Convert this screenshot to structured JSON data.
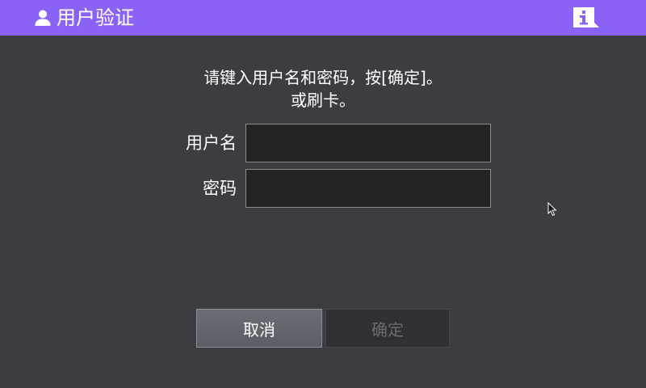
{
  "header": {
    "title": "用户验证",
    "user_icon": "user-icon",
    "info_icon": "info-icon",
    "background": "#8a63f6"
  },
  "prompt": {
    "line1": "请键入用户名和密码，按[确定]。",
    "line2": "或刷卡。"
  },
  "form": {
    "username_label": "用户名",
    "username_value": "",
    "password_label": "密码",
    "password_value": ""
  },
  "buttons": {
    "cancel_label": "取消",
    "ok_label": "确定",
    "ok_enabled": false
  }
}
